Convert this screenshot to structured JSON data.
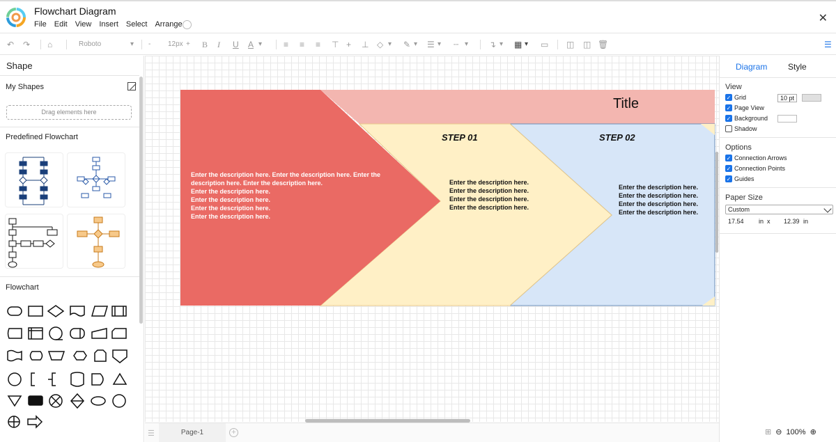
{
  "app": {
    "title": "Flowchart Diagram"
  },
  "menu": [
    "File",
    "Edit",
    "View",
    "Insert",
    "Select",
    "Arrange"
  ],
  "toolbar": {
    "font_family": "Roboto",
    "font_size": "12px",
    "font_size_inc": "+",
    "font_size_dec": "-",
    "bold": "B",
    "italic": "I",
    "underline": "U",
    "text_color": "A"
  },
  "left_panel": {
    "title": "Shape",
    "my_shapes": "My Shapes",
    "drag_hint": "Drag elements here",
    "predefined": "Predefined Flowchart",
    "flowchart": "Flowchart"
  },
  "diagram": {
    "title": "Title",
    "step1": "STEP 01",
    "step2": "STEP 02",
    "desc_main": "Enter the description here. Enter the description here. Enter the description here. Enter the description here.",
    "desc_lines": [
      "Enter the description here.",
      "Enter the description here.",
      "Enter the description here.",
      "Enter the description here."
    ],
    "colors": {
      "red": "#ea6a64",
      "pink": "#f3b6b0",
      "yellow": "#fff0c6",
      "blue": "#d7e6f8"
    }
  },
  "bottom": {
    "page": "Page-1",
    "add": "+"
  },
  "right_panel": {
    "tab_diagram": "Diagram",
    "tab_style": "Style",
    "view": "View",
    "grid": "Grid",
    "grid_size": "10 pt",
    "page_view": "Page View",
    "background": "Background",
    "shadow": "Shadow",
    "options": "Options",
    "connection_arrows": "Connection Arrows",
    "connection_points": "Connection Points",
    "guides": "Guides",
    "paper_size": "Paper Size",
    "paper_preset": "Custom",
    "width_value": "17.54",
    "width_unit": "in",
    "times": "x",
    "height_value": "12.39",
    "height_unit": "in"
  },
  "status": {
    "zoom": "100%"
  }
}
